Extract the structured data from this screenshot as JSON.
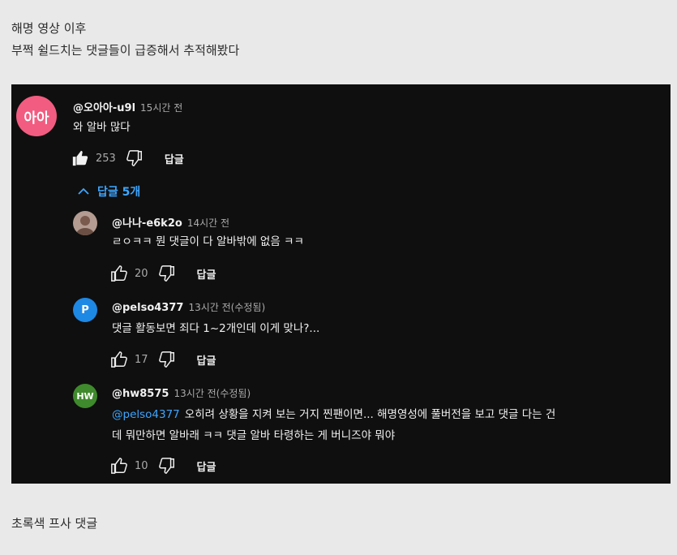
{
  "post": {
    "intro_line1": "해명 영상 이후",
    "intro_line2": "부쩍 쉴드치는 댓글들이 급증해서 추적해봤다",
    "outro": "초록색 프사 댓글"
  },
  "comment": {
    "avatar_text": "아아",
    "avatar_color": "#f25c80",
    "handle": "@오아아-u9l",
    "time": "15시간 전",
    "text": "와 알바 많다",
    "likes": "253",
    "reply_label": "답글"
  },
  "replies_toggle": {
    "label": "답글 5개",
    "accent": "#3ea6ff"
  },
  "replies": [
    {
      "avatar_text": "",
      "avatar_color": "#b49c92",
      "handle": "@나나-e6k2o",
      "time": "14시간 전",
      "mention": "",
      "text": "ㄹㅇㅋㅋ 뭔 댓글이 다 알바밖에 없음 ㅋㅋ",
      "text2": "",
      "likes": "20",
      "reply_label": "답글"
    },
    {
      "avatar_text": "P",
      "avatar_color": "#1e88e5",
      "handle": "@pelso4377",
      "time": "13시간 전(수정됨)",
      "mention": "",
      "text": "댓글 활동보면 죄다 1~2개인데 이게 맞나?...",
      "text2": "",
      "likes": "17",
      "reply_label": "답글"
    },
    {
      "avatar_text": "HW",
      "avatar_color": "#3f8a2c",
      "handle": "@hw8575",
      "time": "13시간 전(수정됨)",
      "mention": "@pelso4377",
      "text": "오히려 상황을 지켜 보는 거지 찐팬이면... 해명영성에 풀버전을 보고 댓글 다는 건",
      "text2": "데 뭐만하면 알바래 ㅋㅋ 댓글 알바 타령하는 게 버니즈야 뭐야",
      "likes": "10",
      "reply_label": "답글"
    }
  ]
}
